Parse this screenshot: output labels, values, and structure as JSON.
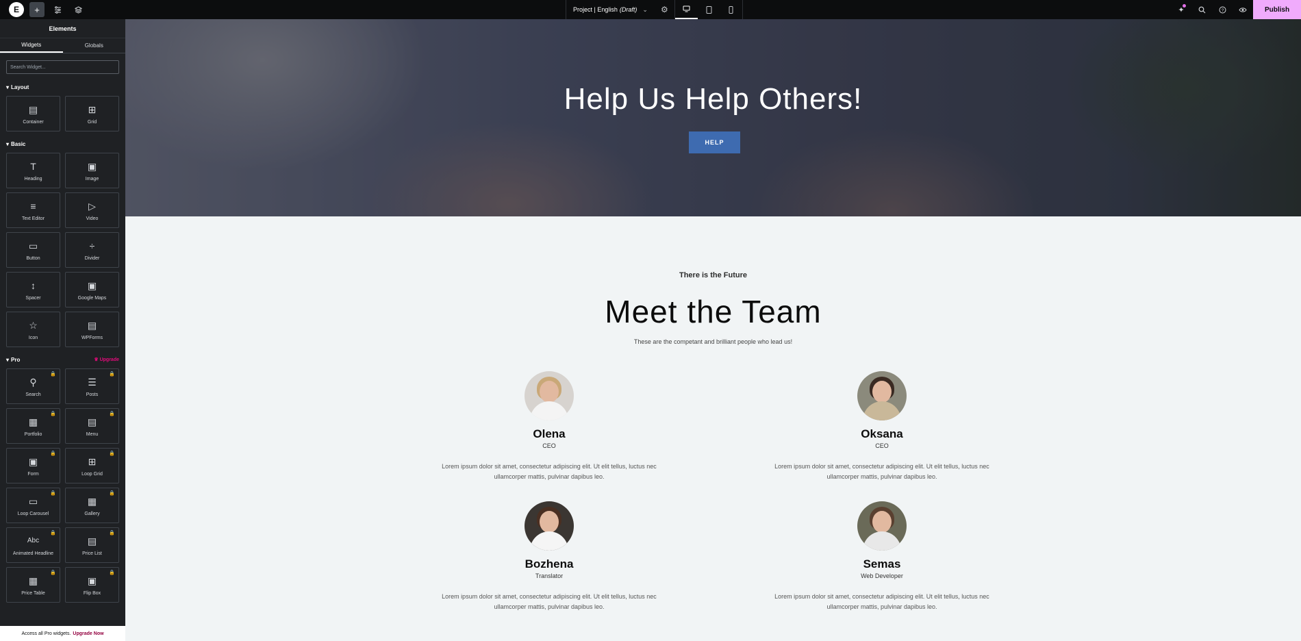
{
  "topbar": {
    "doc_title": "Project | English",
    "doc_status": "(Draft)",
    "publish_label": "Publish",
    "icons": [
      "elementor-logo-icon",
      "add-icon",
      "site-settings-icon",
      "structure-icon",
      "page-settings-icon",
      "desktop-icon",
      "tablet-icon",
      "mobile-icon",
      "whats-new-icon",
      "search-icon",
      "help-icon",
      "preview-icon"
    ]
  },
  "panel": {
    "title": "Elements",
    "tabs": [
      "Widgets",
      "Globals"
    ],
    "search_placeholder": "Search Widget...",
    "categories": {
      "layout": {
        "title": "Layout",
        "items": [
          "Container",
          "Grid"
        ]
      },
      "basic": {
        "title": "Basic",
        "items": [
          "Heading",
          "Image",
          "Text Editor",
          "Video",
          "Button",
          "Divider",
          "Spacer",
          "Google Maps",
          "Icon",
          "WPForms"
        ]
      },
      "pro": {
        "title": "Pro",
        "upgrade": "Upgrade",
        "items": [
          "Search",
          "Posts",
          "Portfolio",
          "Menu",
          "Form",
          "Loop Grid",
          "Loop Carousel",
          "Gallery",
          "Animated Headline",
          "Price List",
          "Price Table",
          "Flip Box"
        ]
      }
    },
    "footer_text": "Access all Pro widgets.",
    "footer_link": "Upgrade Now"
  },
  "hero": {
    "title": "Help Us Help Others!",
    "button": "HELP"
  },
  "team": {
    "subtitle": "There is the Future",
    "title": "Meet the Team",
    "description": "These are the competant and brilliant people who lead us!",
    "members": [
      {
        "name": "Olena",
        "role": "CEO",
        "text": "Lorem ipsum dolor sit amet, consectetur adipiscing elit. Ut elit tellus, luctus nec ullamcorper mattis, pulvinar dapibus leo."
      },
      {
        "name": "Oksana",
        "role": "CEO",
        "text": "Lorem ipsum dolor sit amet, consectetur adipiscing elit. Ut elit tellus, luctus nec ullamcorper mattis, pulvinar dapibus leo."
      },
      {
        "name": "Bozhena",
        "role": "Translator",
        "text": "Lorem ipsum dolor sit amet, consectetur adipiscing elit. Ut elit tellus, luctus nec ullamcorper mattis, pulvinar dapibus leo."
      },
      {
        "name": "Semas",
        "role": "Web Developer",
        "text": "Lorem ipsum dolor sit amet, consectetur adipiscing elit. Ut elit tellus, luctus nec ullamcorper mattis, pulvinar dapibus leo."
      }
    ]
  },
  "colors": {
    "accent": "#f0abfc",
    "help_button": "#3e6bb0",
    "upgrade": "#e30b7b"
  }
}
